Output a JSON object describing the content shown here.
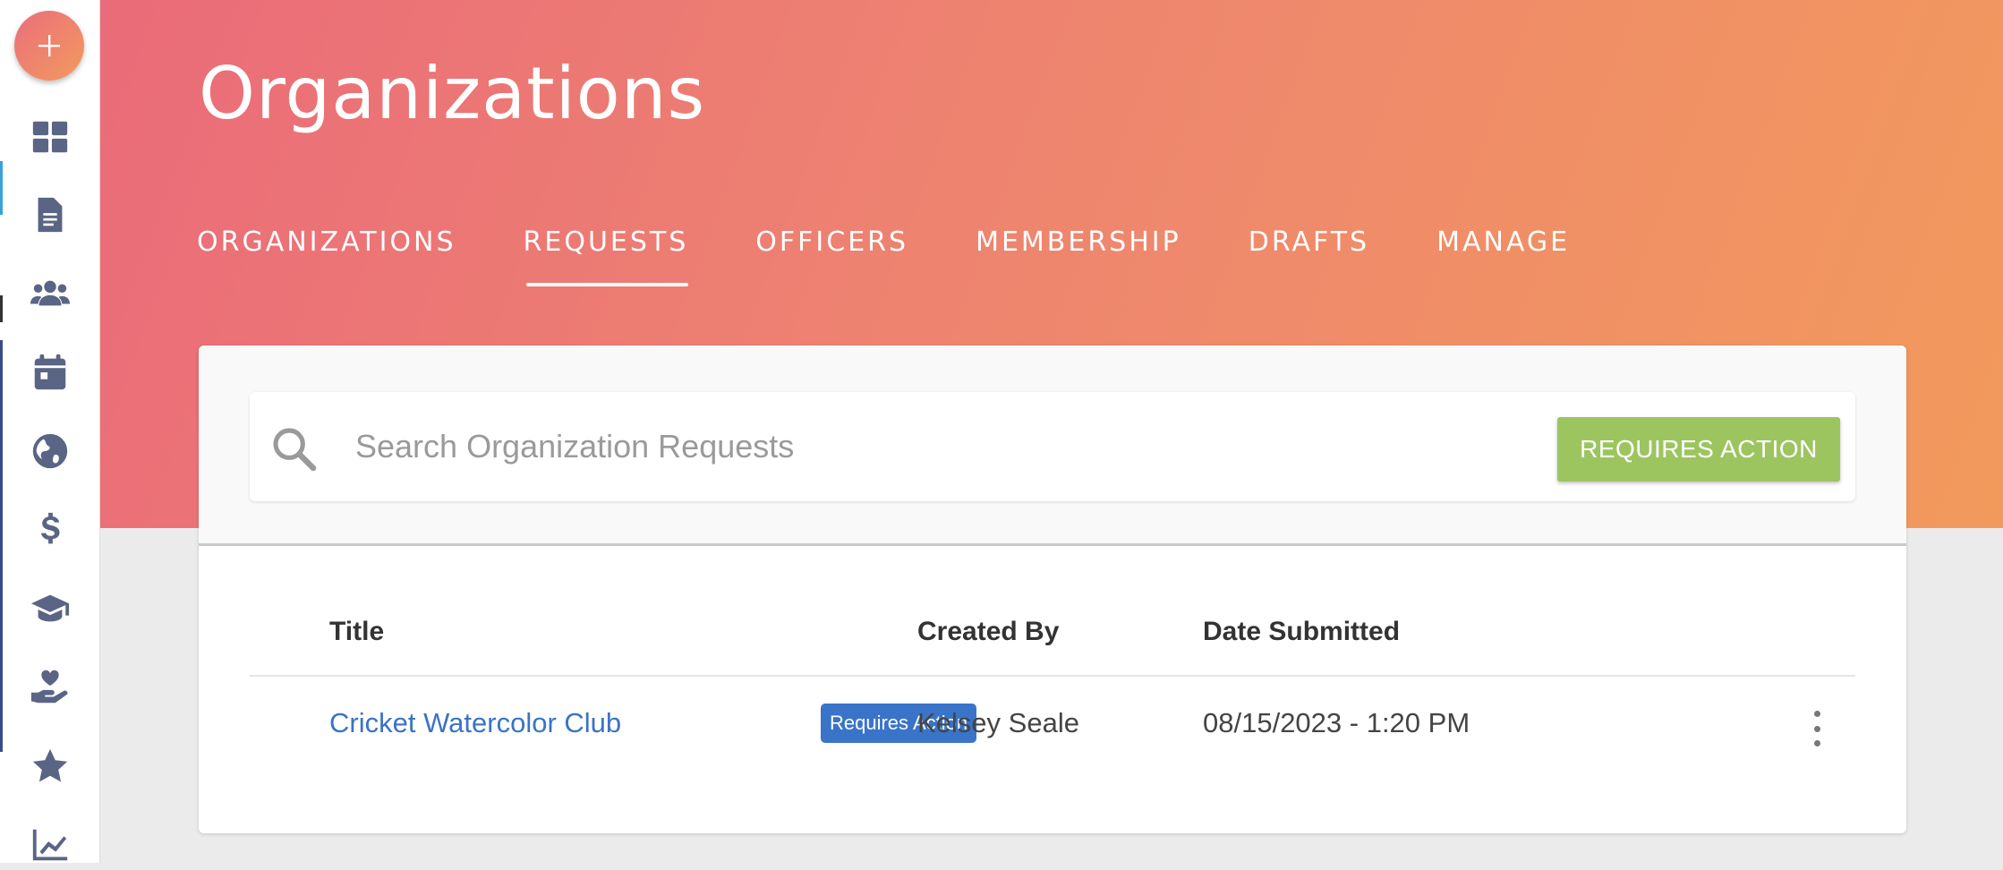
{
  "header": {
    "title": "Organizations",
    "gradient_start": "#ea6b79",
    "gradient_end": "#f29a5c"
  },
  "tabs": [
    {
      "label": "ORGANIZATIONS",
      "active": false
    },
    {
      "label": "REQUESTS",
      "active": true
    },
    {
      "label": "OFFICERS",
      "active": false
    },
    {
      "label": "MEMBERSHIP",
      "active": false
    },
    {
      "label": "DRAFTS",
      "active": false
    },
    {
      "label": "MANAGE",
      "active": false
    }
  ],
  "sidebar": {
    "fab_icon": "plus-icon",
    "items": [
      {
        "icon": "dashboard-icon"
      },
      {
        "icon": "document-icon"
      },
      {
        "icon": "users-icon"
      },
      {
        "icon": "calendar-icon"
      },
      {
        "icon": "globe-icon"
      },
      {
        "icon": "dollar-icon"
      },
      {
        "icon": "graduation-cap-icon"
      },
      {
        "icon": "hand-heart-icon"
      },
      {
        "icon": "star-icon"
      },
      {
        "icon": "chart-line-icon"
      }
    ]
  },
  "search": {
    "placeholder": "Search Organization Requests",
    "value": ""
  },
  "filter_button": {
    "label": "REQUIRES ACTION",
    "color": "#9cc560"
  },
  "table": {
    "columns": [
      "Title",
      "Created By",
      "Date Submitted"
    ],
    "rows": [
      {
        "title": "Cricket Watercolor Club",
        "badge": "Requires Action",
        "created_by": "Kelsey Seale",
        "date_submitted": "08/15/2023 - 1:20 PM"
      }
    ]
  }
}
